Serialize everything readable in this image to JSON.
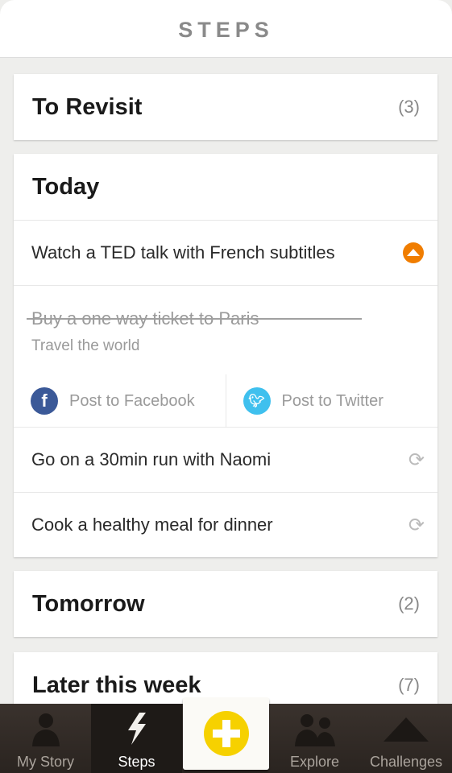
{
  "header": {
    "title": "STEPS"
  },
  "sections": {
    "revisit": {
      "title": "To Revisit",
      "count": "(3)"
    },
    "today": {
      "title": "Today",
      "items": [
        {
          "text": "Watch a TED talk with French subtitles",
          "icon": "orange-up-arrow-icon"
        },
        {
          "text": "Buy a one way ticket to Paris",
          "subtitle": "Travel the world",
          "completed": true
        },
        {
          "text": "Go on a 30min run with Naomi",
          "icon": "repeat-icon"
        },
        {
          "text": "Cook a healthy meal for dinner",
          "icon": "repeat-icon"
        }
      ],
      "share": {
        "facebook": "Post to Facebook",
        "twitter": "Post to Twitter"
      }
    },
    "tomorrow": {
      "title": "Tomorrow",
      "count": "(2)"
    },
    "later": {
      "title": "Later this week",
      "count": "(7)"
    }
  },
  "tabbar": {
    "items": [
      {
        "label": "My Story"
      },
      {
        "label": "Steps",
        "active": true
      },
      {
        "label": "Explore"
      },
      {
        "label": "Challenges"
      }
    ]
  },
  "colors": {
    "accent_orange": "#f07d00",
    "add_yellow": "#f6d100",
    "facebook": "#3b5998",
    "twitter": "#3fc0ee"
  }
}
